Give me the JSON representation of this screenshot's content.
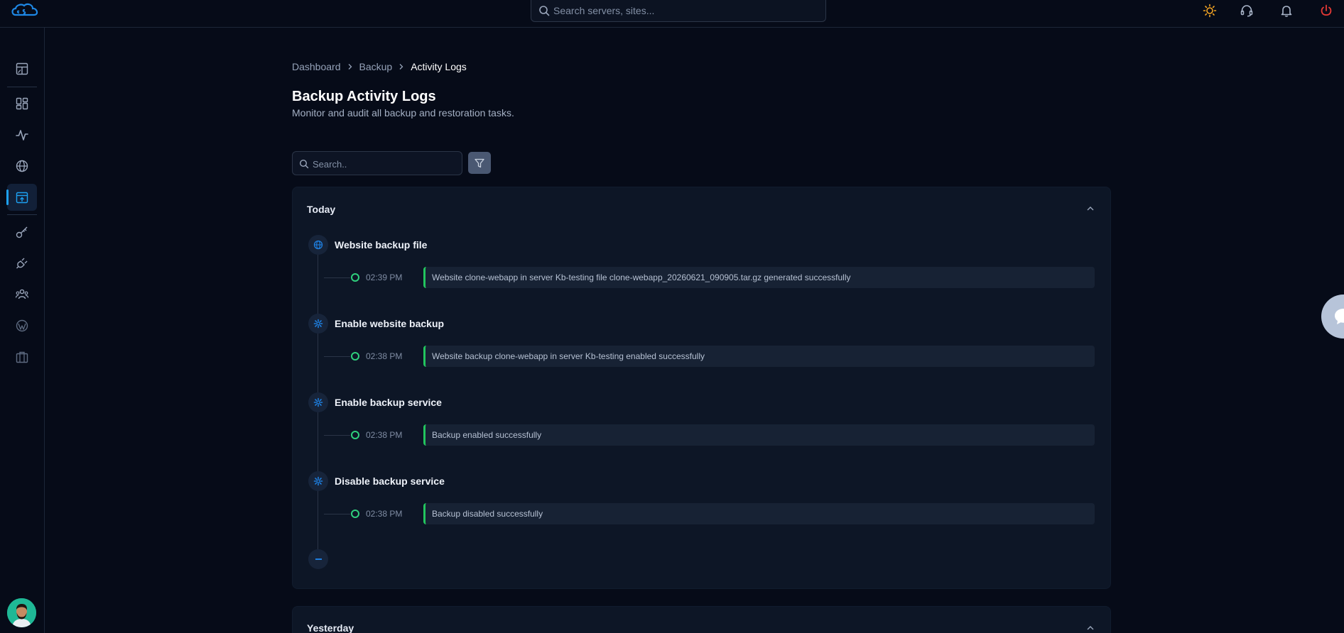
{
  "app": {
    "logo_name": "cSb-logo"
  },
  "topbar": {
    "search_placeholder": "Search servers, sites...",
    "icons": [
      "sun-icon",
      "headset-icon",
      "bell-icon",
      "power-icon"
    ],
    "colors": {
      "sun": "#f5a623",
      "power": "#e53935"
    }
  },
  "sidebar": {
    "items": [
      {
        "name": "sidebar-item-dashboard",
        "icon": "layout-dashboard-icon"
      },
      {
        "name": "sidebar-item-apps",
        "icon": "grid-icon"
      },
      {
        "name": "sidebar-item-monitoring",
        "icon": "activity-icon"
      },
      {
        "name": "sidebar-item-websites",
        "icon": "globe-icon"
      },
      {
        "name": "sidebar-item-backup",
        "icon": "archive-icon",
        "active": true
      },
      {
        "name": "sidebar-item-keys",
        "icon": "key-icon"
      },
      {
        "name": "sidebar-item-integrations",
        "icon": "plug-icon"
      },
      {
        "name": "sidebar-item-team",
        "icon": "users-icon"
      },
      {
        "name": "sidebar-item-wordpress",
        "icon": "wordpress-icon"
      },
      {
        "name": "sidebar-item-toolbox",
        "icon": "briefcase-icon"
      }
    ]
  },
  "breadcrumb": {
    "items": [
      "Dashboard",
      "Backup"
    ],
    "current": "Activity Logs"
  },
  "page": {
    "title": "Backup Activity Logs",
    "subtitle": "Monitor and audit all backup and restoration tasks."
  },
  "filters": {
    "search_placeholder": "Search.."
  },
  "sections": [
    {
      "label": "Today",
      "groups": [
        {
          "title": "Website backup file",
          "icon": "globe-icon",
          "time": "02:39 PM",
          "message": "Website clone-webapp in server Kb-testing file clone-webapp_20260621_090905.tar.gz generated successfully"
        },
        {
          "title": "Enable website backup",
          "icon": "gear-icon",
          "time": "02:38 PM",
          "message": "Website backup clone-webapp in server Kb-testing enabled successfully"
        },
        {
          "title": "Enable backup service",
          "icon": "gear-icon",
          "time": "02:38 PM",
          "message": "Backup enabled successfully"
        },
        {
          "title": "Disable backup service",
          "icon": "gear-icon",
          "time": "02:38 PM",
          "message": "Backup disabled successfully"
        }
      ]
    },
    {
      "label": "Yesterday"
    }
  ],
  "colors": {
    "accent": "#1da1f2",
    "success": "#22c55e",
    "background": "#060b18",
    "card": "#0d1626"
  }
}
